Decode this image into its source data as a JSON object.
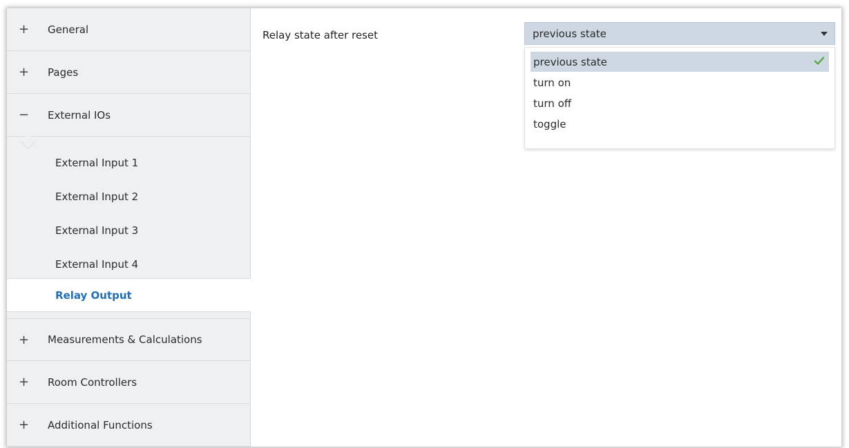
{
  "sidebar": {
    "groups_top": [
      {
        "sign": "+",
        "label": "General"
      },
      {
        "sign": "+",
        "label": "Pages"
      },
      {
        "sign": "−",
        "label": "External IOs"
      }
    ],
    "subitems": [
      {
        "label": "External Input 1"
      },
      {
        "label": "External Input 2"
      },
      {
        "label": "External Input 3"
      },
      {
        "label": "External Input 4"
      },
      {
        "label": "Relay Output",
        "selected": true
      }
    ],
    "groups_bottom": [
      {
        "sign": "+",
        "label": "Measurements & Calculations"
      },
      {
        "sign": "+",
        "label": "Room Controllers"
      },
      {
        "sign": "+",
        "label": "Additional Functions"
      }
    ]
  },
  "main": {
    "parameter_label": "Relay state after reset",
    "select": {
      "value": "previous state",
      "options": [
        "previous state",
        "turn on",
        "turn off",
        "toggle"
      ],
      "selected_index": 0
    }
  },
  "colors": {
    "selected_text": "#1f6fbf",
    "check": "#5aa846",
    "select_bg": "#cdd8e3"
  }
}
